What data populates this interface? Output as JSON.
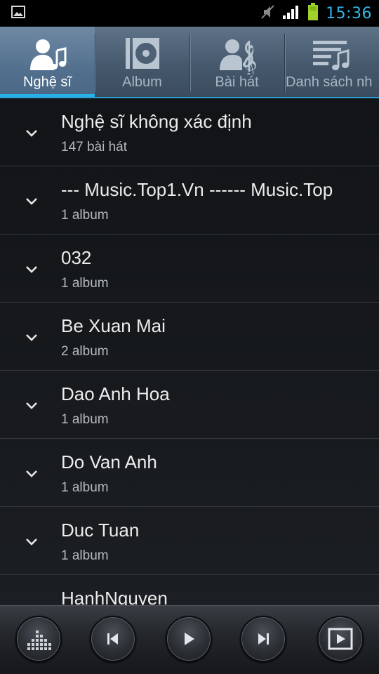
{
  "status_bar": {
    "time": "15:36",
    "icons": [
      "gallery-icon",
      "mute-icon",
      "signal-icon",
      "battery-icon"
    ],
    "time_color": "#31b6e7"
  },
  "tabs": [
    {
      "label": "Nghệ sĩ",
      "icon": "artist-icon",
      "active": true
    },
    {
      "label": "Album",
      "icon": "album-icon",
      "active": false
    },
    {
      "label": "Bài hát",
      "icon": "song-icon",
      "active": false
    },
    {
      "label": "Danh sách nh",
      "icon": "playlist-icon",
      "active": false
    }
  ],
  "artists": [
    {
      "name": "Nghệ sĩ không xác định",
      "count": "147 bài hát"
    },
    {
      "name": "--- Music.Top1.Vn ------ Music.Top",
      "count": "1 album"
    },
    {
      "name": "032",
      "count": "1 album"
    },
    {
      "name": "Be Xuan Mai",
      "count": "2 album"
    },
    {
      "name": "Dao Anh Hoa",
      "count": "1 album"
    },
    {
      "name": "Do Van Anh",
      "count": "1 album"
    },
    {
      "name": "Duc Tuan",
      "count": "1 album"
    },
    {
      "name": "HanhNguyen",
      "count": ""
    }
  ],
  "player": {
    "buttons": [
      "equalizer-button",
      "previous-button",
      "play-button",
      "next-button",
      "now-playing-button"
    ]
  },
  "colors": {
    "accent": "#27b1e6",
    "tab_bar": "#45586c",
    "list_bg": "#16181b"
  }
}
